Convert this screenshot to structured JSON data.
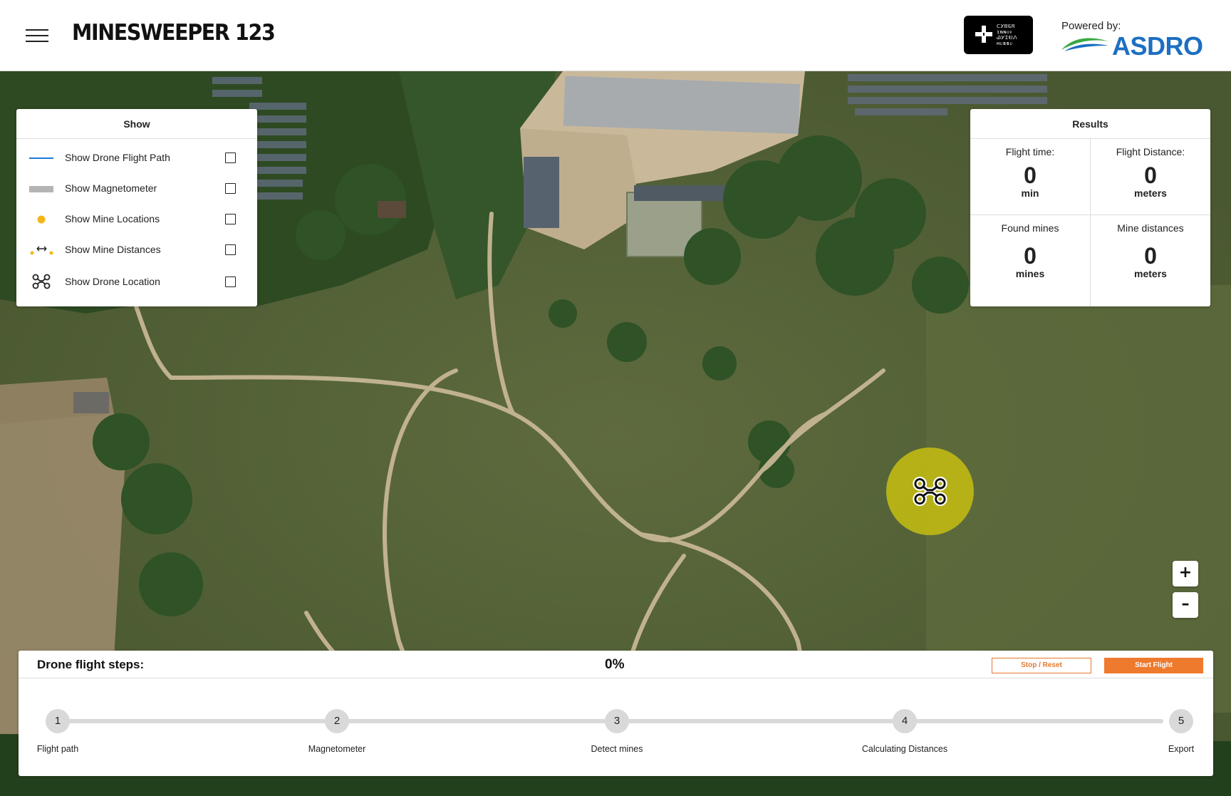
{
  "header": {
    "menu_icon": "hamburger-icon",
    "title": "MINESWEEPER 123",
    "cyber_logo_glyphs": [
      "ᑕᎩᏴᏋᏒ",
      "ɪɴɴᴏᴠ",
      "ᏊᎩᏆᎧᏁ",
      "ʜᴜʙʙᴜ"
    ],
    "powered_label": "Powered by:",
    "partner_name": "ASDRO",
    "colors": {
      "partner_blue": "#1c6fc2",
      "partner_green": "#3aa846"
    }
  },
  "show_panel": {
    "title": "Show",
    "items": [
      {
        "icon": "flight-path-line-icon",
        "label": "Show Drone Flight Path",
        "checked": false
      },
      {
        "icon": "magnetometer-bar-icon",
        "label": "Show Magnetometer",
        "checked": false
      },
      {
        "icon": "mine-dot-icon",
        "label": "Show Mine Locations",
        "checked": false
      },
      {
        "icon": "mine-distance-icon",
        "label": "Show Mine Distances",
        "checked": false
      },
      {
        "icon": "drone-icon",
        "label": "Show Drone Location",
        "checked": false
      }
    ]
  },
  "results_panel": {
    "title": "Results",
    "cells": [
      {
        "label": "Flight time:",
        "value": "0",
        "unit": "min"
      },
      {
        "label": "Flight Distance:",
        "value": "0",
        "unit": "meters"
      },
      {
        "label": "Found mines",
        "value": "0",
        "unit": "mines"
      },
      {
        "label": "Mine distances",
        "value": "0",
        "unit": "meters"
      }
    ]
  },
  "map": {
    "drone_icon": "drone-icon",
    "drone_marker_color": "#c6be12",
    "zoom_in_label": "+",
    "zoom_out_label": "–"
  },
  "steps_panel": {
    "title": "Drone flight steps:",
    "progress_label": "0%",
    "progress": 0,
    "stop_label": "Stop / Reset",
    "start_label": "Start Flight",
    "accent_color": "#ee7a2d",
    "steps": [
      {
        "number": "1",
        "label": "Flight path"
      },
      {
        "number": "2",
        "label": "Magnetometer"
      },
      {
        "number": "3",
        "label": "Detect mines"
      },
      {
        "number": "4",
        "label": "Calculating Distances"
      },
      {
        "number": "5",
        "label": "Export"
      }
    ]
  }
}
